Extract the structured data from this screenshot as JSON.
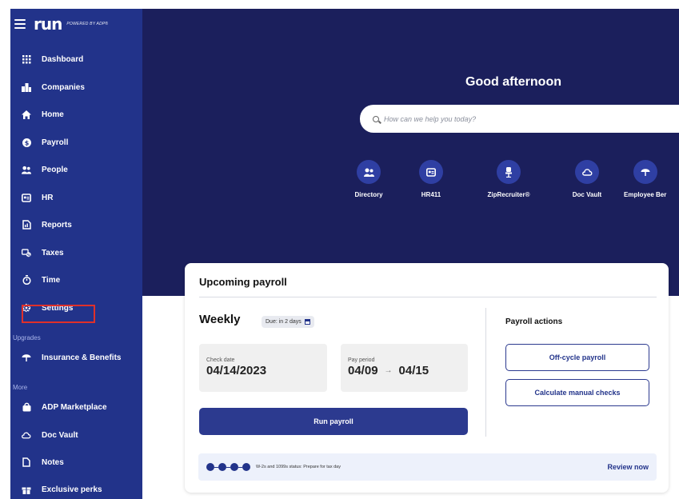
{
  "sidebar": {
    "logo_text": "run",
    "powered_by": "POWERED BY ADP®",
    "items": [
      {
        "label": "Dashboard",
        "icon": "grid-icon"
      },
      {
        "label": "Companies",
        "icon": "building-icon"
      },
      {
        "label": "Home",
        "icon": "home-icon"
      },
      {
        "label": "Payroll",
        "icon": "dollar-icon"
      },
      {
        "label": "People",
        "icon": "people-icon"
      },
      {
        "label": "HR",
        "icon": "id-card-icon"
      },
      {
        "label": "Reports",
        "icon": "report-icon"
      },
      {
        "label": "Taxes",
        "icon": "tax-icon"
      },
      {
        "label": "Time",
        "icon": "stopwatch-icon"
      },
      {
        "label": "Settings",
        "icon": "gear-icon"
      }
    ],
    "upgrades_label": "Upgrades",
    "upgrades_items": [
      {
        "label": "Insurance & Benefits",
        "icon": "umbrella-icon"
      }
    ],
    "more_label": "More",
    "more_items": [
      {
        "label": "ADP Marketplace",
        "icon": "bag-icon"
      },
      {
        "label": "Doc Vault",
        "icon": "cloud-lock-icon"
      },
      {
        "label": "Notes",
        "icon": "note-icon"
      },
      {
        "label": "Exclusive perks",
        "icon": "gift-icon"
      }
    ]
  },
  "hero": {
    "greeting": "Good afternoon",
    "search_placeholder": "How can we help you today?",
    "quick_links": [
      {
        "label": "Directory",
        "icon": "people-icon"
      },
      {
        "label": "HR411",
        "icon": "id-card-icon"
      },
      {
        "label": "ZipRecruiter®",
        "icon": "chair-icon"
      },
      {
        "label": "Doc Vault",
        "icon": "cloud-lock-icon"
      },
      {
        "label": "Employee Ber",
        "icon": "umbrella-icon"
      }
    ]
  },
  "payroll_card": {
    "title": "Upcoming payroll",
    "frequency": "Weekly",
    "due_badge": "Due: in 2 days",
    "check_date_label": "Check date",
    "check_date": "04/14/2023",
    "pay_period_label": "Pay period",
    "pay_period_start": "04/09",
    "pay_period_arrow": "→",
    "pay_period_end": "04/15",
    "run_button": "Run payroll",
    "actions_title": "Payroll actions",
    "off_cycle_button": "Off-cycle payroll",
    "manual_checks_button": "Calculate manual checks",
    "status_text": "W-2s and 1099s status: Prepare for tax day",
    "review_link": "Review now"
  },
  "colors": {
    "sidebar_bg": "#22338a",
    "hero_bg": "#1b1f5c",
    "accent": "#2c3a8f",
    "highlight_border": "#e0302a"
  }
}
